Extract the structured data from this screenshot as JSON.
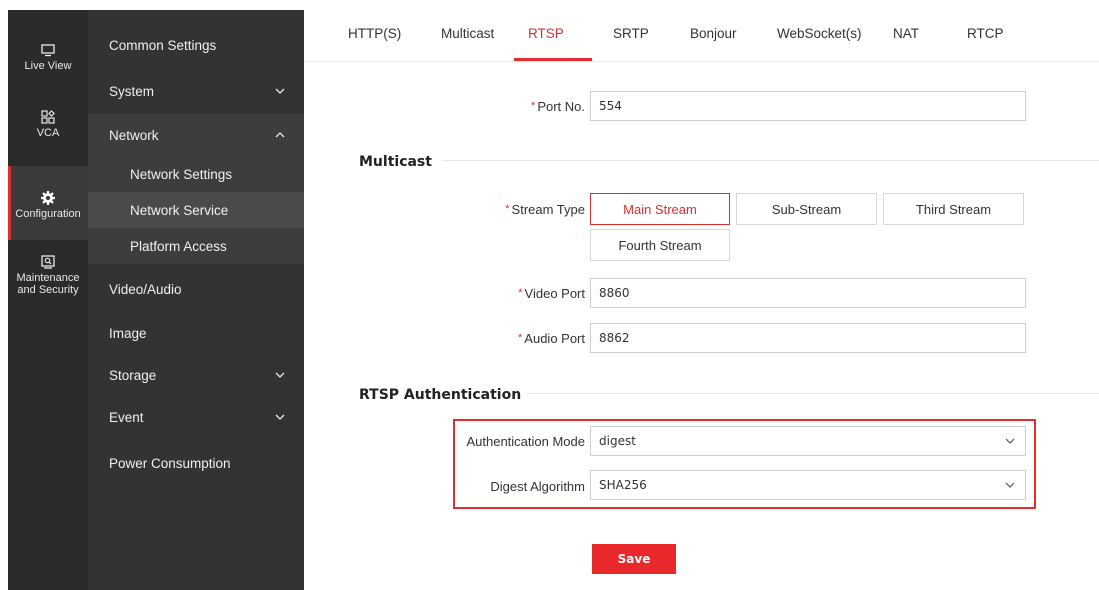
{
  "rail": {
    "items": [
      {
        "label": "Live View",
        "icon": "monitor-icon"
      },
      {
        "label": "VCA",
        "icon": "vca-icon"
      },
      {
        "label": "Configuration",
        "icon": "gear-icon"
      },
      {
        "label_line1": "Maintenance",
        "label_line2": "and Security",
        "icon": "maintenance-icon"
      }
    ]
  },
  "menu": {
    "common_settings": "Common Settings",
    "system": "System",
    "network": "Network",
    "network_settings": "Network Settings",
    "network_service": "Network Service",
    "platform_access": "Platform Access",
    "video_audio": "Video/Audio",
    "image": "Image",
    "storage": "Storage",
    "event": "Event",
    "power_consumption": "Power Consumption"
  },
  "tabs": [
    "HTTP(S)",
    "Multicast",
    "RTSP",
    "SRTP",
    "Bonjour",
    "WebSocket(s)",
    "NAT",
    "RTCP"
  ],
  "active_tab": "RTSP",
  "form": {
    "port_label": "Port No.",
    "port_value": "554",
    "multicast_title": "Multicast",
    "stream_type_label": "Stream Type",
    "streams": [
      "Main Stream",
      "Sub-Stream",
      "Third Stream",
      "Fourth Stream"
    ],
    "selected_stream": "Main Stream",
    "video_port_label": "Video Port",
    "video_port_value": "8860",
    "audio_port_label": "Audio Port",
    "audio_port_value": "8862",
    "rtsp_auth_title": "RTSP Authentication",
    "auth_mode_label": "Authentication Mode",
    "auth_mode_value": "digest",
    "digest_algo_label": "Digest Algorithm",
    "digest_algo_value": "SHA256",
    "save_label": "Save",
    "required_mark": "*"
  },
  "colors": {
    "accent": "#e02d2d",
    "rail_bg": "#2b2b2b",
    "menu_bg": "#333333"
  }
}
